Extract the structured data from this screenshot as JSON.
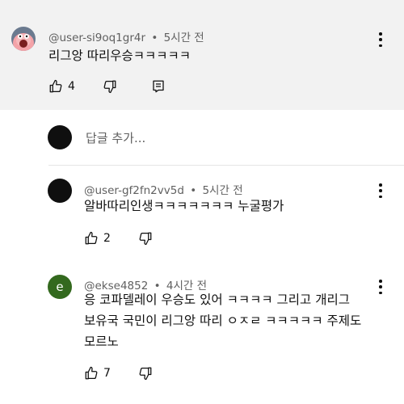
{
  "comments": [
    {
      "handle": "@user-si9oq1gr4r",
      "time": "5시간 전",
      "text": "리그앙 따리우승ㅋㅋㅋㅋㅋ",
      "likes": "4"
    },
    {
      "handle": "@user-gf2fn2vv5d",
      "time": "5시간 전",
      "text": "알바따리인생ㅋㅋㅋㅋㅋㅋㅋ 누굴평가",
      "likes": "2"
    },
    {
      "handle": "@ekse4852",
      "avatar_letter": "e",
      "time": "4시간 전",
      "text_line1": "응 코파델레이 우승도 있어 ㅋㅋㅋㅋ 그리고 개리그",
      "text_line2": "보유국 국민이 리그앙 따리 ㅇㅈㄹ ㅋㅋㅋㅋㅋ 주제도",
      "text_line3": "모르노",
      "likes": "7"
    }
  ],
  "reply_box": {
    "placeholder": "답글 추가..."
  },
  "meta_separator": "•",
  "icons": {
    "like": "thumbs-up-icon",
    "dislike": "thumbs-down-icon",
    "reply": "reply-comment-icon",
    "more": "more-vert-icon"
  },
  "colors": {
    "highlight_bg": "#f2f2f2",
    "secondary_text": "#606060",
    "avatar_green": "#33691e"
  }
}
